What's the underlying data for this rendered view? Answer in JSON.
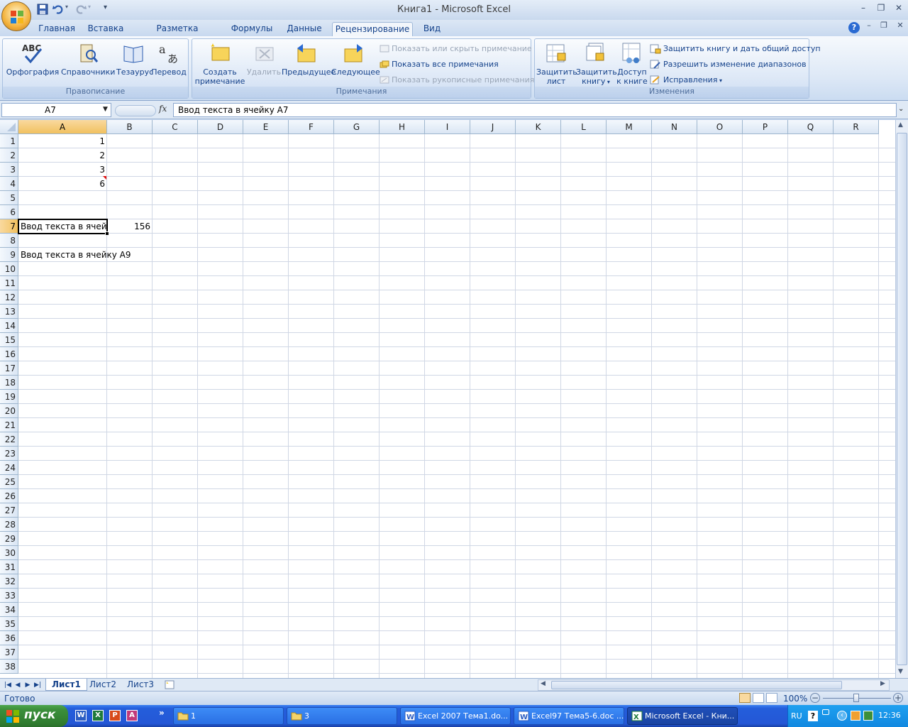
{
  "window": {
    "title": "Книга1 - Microsoft Excel",
    "controls": [
      "–",
      "❐",
      "✕"
    ],
    "doc_controls": [
      "–",
      "❐",
      "✕"
    ]
  },
  "quick_access": {
    "icons": [
      "save-icon",
      "undo-icon",
      "redo-icon",
      "customize-icon"
    ]
  },
  "ribbon_tabs": [
    {
      "label": "Главная"
    },
    {
      "label": "Вставка"
    },
    {
      "label": "Разметка страницы"
    },
    {
      "label": "Формулы"
    },
    {
      "label": "Данные"
    },
    {
      "label": "Рецензирование",
      "active": true
    },
    {
      "label": "Вид"
    }
  ],
  "ribbon": {
    "proofing": {
      "label": "Правописание",
      "spelling": "Орфография",
      "research": "Справочники",
      "thesaurus": "Тезаурус",
      "translate": "Перевод"
    },
    "comments": {
      "label": "Примечания",
      "new_line1": "Создать",
      "new_line2": "примечание",
      "delete": "Удалить",
      "previous": "Предыдущее",
      "next": "Следующее",
      "show_hide": "Показать или скрыть примечание",
      "show_all": "Показать все примечания",
      "show_ink": "Показать рукописные примечания"
    },
    "changes": {
      "label": "Изменения",
      "protect_sheet_1": "Защитить",
      "protect_sheet_2": "лист",
      "protect_book_1": "Защитить",
      "protect_book_2": "книгу",
      "share_1": "Доступ",
      "share_2": "к книге",
      "protect_share": "Защитить книгу и дать общий доступ",
      "allow_ranges": "Разрешить изменение диапазонов",
      "track_changes": "Исправления"
    }
  },
  "formula_bar": {
    "name_box": "A7",
    "fx": "fx",
    "value": "Ввод текста в ячейку A7"
  },
  "sheet": {
    "columns": [
      "A",
      "B",
      "C",
      "D",
      "E",
      "F",
      "G",
      "H",
      "I",
      "J",
      "K",
      "L",
      "M",
      "N",
      "O",
      "P",
      "Q",
      "R"
    ],
    "rows": [
      "1",
      "2",
      "3",
      "4",
      "5",
      "6",
      "7",
      "8",
      "9",
      "10",
      "11",
      "12",
      "13",
      "14",
      "15",
      "16",
      "17",
      "18",
      "19",
      "20",
      "21",
      "22",
      "23",
      "24",
      "25",
      "26",
      "27",
      "28",
      "29",
      "30",
      "31",
      "32",
      "33",
      "34",
      "35",
      "36",
      "37",
      "38"
    ],
    "selected_column": "A",
    "selected_row": "7",
    "cells": {
      "A1": "1",
      "A2": "2",
      "A3": "3",
      "A4": "6",
      "A7": "Ввод текста в ячейн",
      "B7": "156",
      "A9": "Ввод текста в ячейку A9"
    }
  },
  "sheet_tabs": [
    {
      "label": "Лист1",
      "active": true
    },
    {
      "label": "Лист2"
    },
    {
      "label": "Лист3"
    }
  ],
  "status": {
    "text": "Готово",
    "zoom": "100%"
  },
  "taskbar": {
    "start": "пуск",
    "items": [
      {
        "label": "1"
      },
      {
        "label": "3"
      },
      {
        "label": "Excel 2007 Тема1.do..."
      },
      {
        "label": "Excel97 Тема5-6.doc ..."
      },
      {
        "label": "Microsoft Excel - Кни...",
        "active": true
      }
    ],
    "lang": "RU",
    "clock": "12:36"
  },
  "colors": {
    "accent": "#15428b",
    "selection_header": "#f1c15f",
    "taskbar": "#245edb",
    "start_button": "#3c8f3c"
  }
}
